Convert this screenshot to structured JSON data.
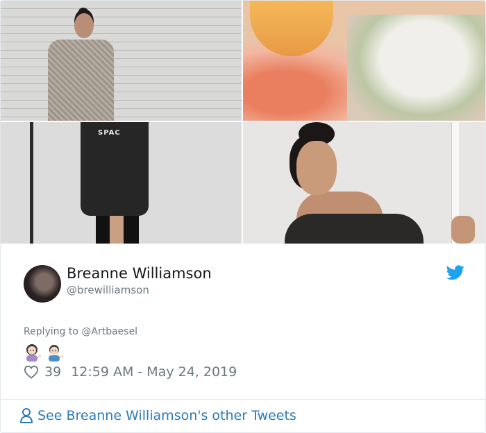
{
  "tweet": {
    "author_name": "Breanne Williamson",
    "author_handle": "@brewilliamson",
    "replying_to": "Replying to @Artbaesel",
    "like_count": "39",
    "timestamp": "12:59 AM - May 24, 2019",
    "cta": "See Breanne Williamson's other Tweets",
    "image_text": "SPAC"
  },
  "colors": {
    "twitter_blue": "#1da1f2",
    "link_blue": "#2b7bb9",
    "muted": "#697882",
    "border": "#e1e8ed"
  },
  "icons": {
    "platform": "twitter-bird-icon",
    "like": "heart-icon",
    "profile": "person-icon",
    "emojis": [
      "woman-tipping-hand-emoji",
      "man-tipping-hand-emoji"
    ]
  }
}
